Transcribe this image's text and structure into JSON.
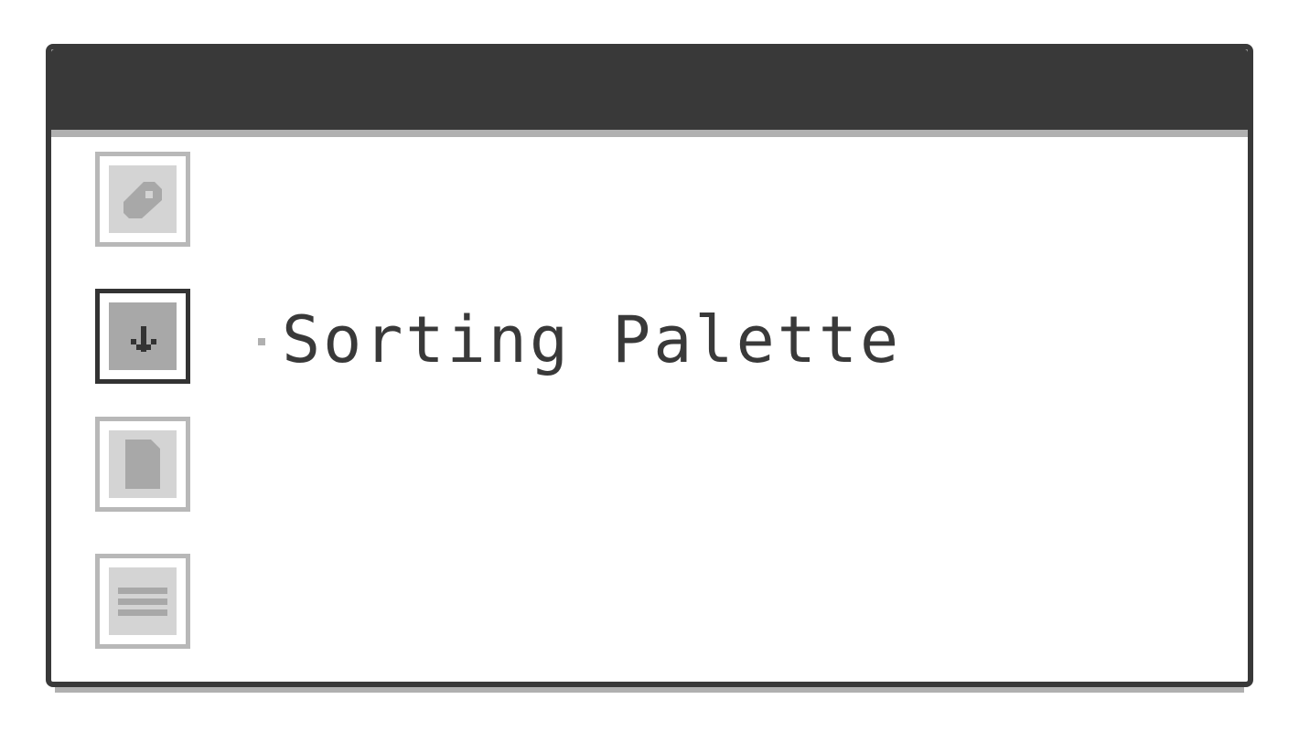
{
  "window": {
    "title": ""
  },
  "palette": {
    "label": "Sorting Palette",
    "tools": [
      {
        "name": "tag-tool",
        "icon": "tag-icon",
        "active": false
      },
      {
        "name": "sort-down-tool",
        "icon": "arrow-down-icon",
        "active": true
      },
      {
        "name": "document-tool",
        "icon": "document-icon",
        "active": false
      },
      {
        "name": "list-tool",
        "icon": "lines-icon",
        "active": false
      }
    ]
  },
  "colors": {
    "frame": "#393939",
    "shadow": "#b0b0b0",
    "button_border": "#b8b8b8",
    "button_fill": "#d4d4d4",
    "active_fill": "#a8a8a8"
  }
}
